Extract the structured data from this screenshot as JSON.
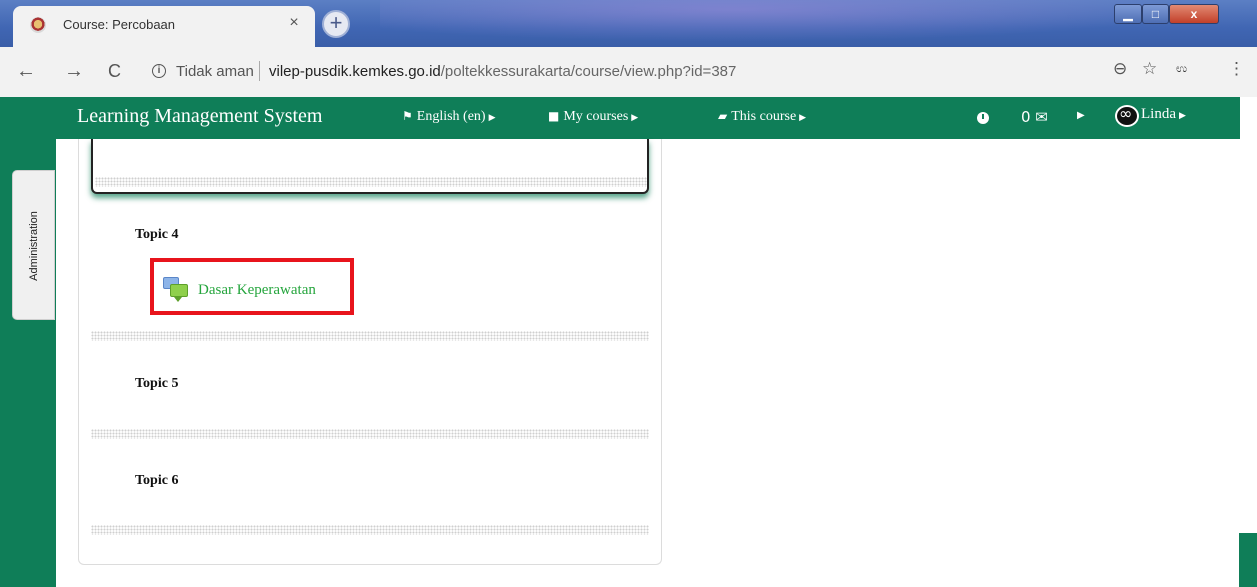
{
  "browser": {
    "tab_title": "Course: Percobaan",
    "tab_close": "×",
    "new_tab": "+",
    "security_label": "Tidak aman",
    "url_host": "vilep-pusdik.kemkes.go.id",
    "url_path": "/poltekkessurakarta/course/view.php?id=387",
    "icons": {
      "back": "←",
      "forward": "→",
      "reload": "C",
      "info": "i",
      "zoom": "⊖",
      "bookmark": "☆",
      "menu": "⋮"
    }
  },
  "window": {
    "minimize": "▁",
    "maximize": "□",
    "close": "x"
  },
  "navbar": {
    "brand": "Learning Management System",
    "language": "English (en)",
    "my_courses": "My courses",
    "this_course": "This course",
    "messages": "0 ✉",
    "user": "Linda",
    "colors": {
      "background": "#0f7e58",
      "text": "#ffffff"
    }
  },
  "sidebar": {
    "administration_label": "Administration"
  },
  "course": {
    "topics": [
      {
        "name": "Topic 4",
        "activities": [
          {
            "label": "Dasar Keperawatan",
            "type": "forum"
          }
        ]
      },
      {
        "name": "Topic 5",
        "activities": []
      },
      {
        "name": "Topic 6",
        "activities": []
      }
    ],
    "colors": {
      "activity_link": "#25a53d",
      "highlight_border": "#e8141c"
    }
  }
}
